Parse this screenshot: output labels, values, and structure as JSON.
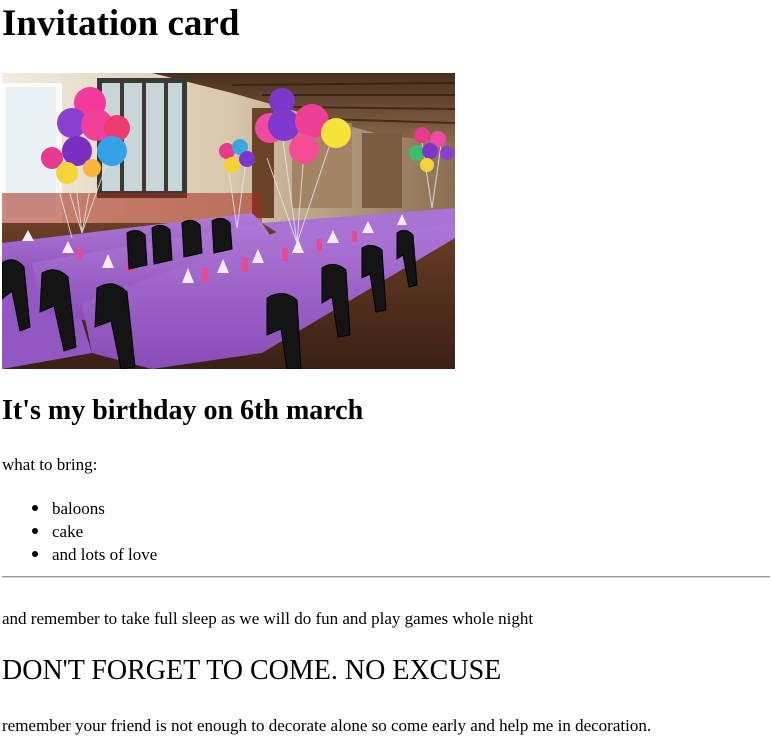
{
  "heading": "Invitation card",
  "photo": {
    "subject": "party-hall-with-balloons",
    "colors": {
      "tablecloth": "#9b5fc8",
      "floor": "#5a3422",
      "wall": "#e9dcc6"
    }
  },
  "subheading": "It's my birthday on 6th march",
  "bring_label": "what to bring:",
  "bring_items": [
    "baloons",
    "cake",
    "and lots of love"
  ],
  "reminder": "and remember to take full sleep as we will do fun and play games whole night",
  "warning": "DON'T FORGET TO COME. NO EXCUSE",
  "friend_note": "remember your friend is not enough to decorate alone so come early and help me in decoration."
}
